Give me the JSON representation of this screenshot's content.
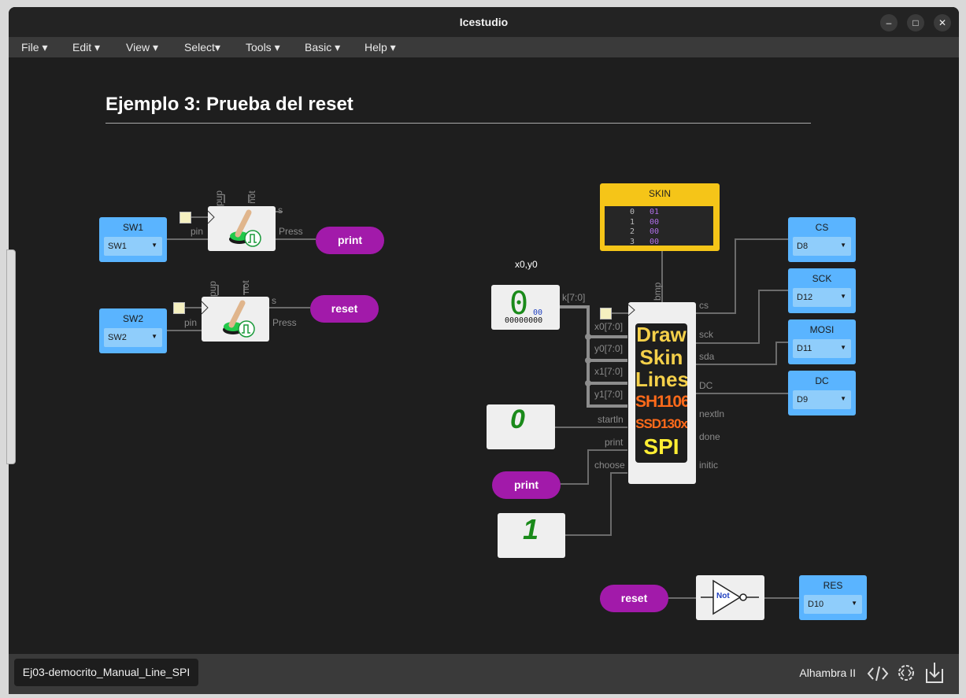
{
  "window": {
    "title": "Icestudio",
    "minimize_glyph": "–",
    "maximize_glyph": "□",
    "close_glyph": "✕"
  },
  "menubar": {
    "items": [
      {
        "label": "File ▾"
      },
      {
        "label": "Edit ▾"
      },
      {
        "label": "View ▾"
      },
      {
        "label": "Select▾"
      },
      {
        "label": "Tools ▾"
      },
      {
        "label": "Basic ▾"
      },
      {
        "label": "Help ▾"
      }
    ]
  },
  "canvas": {
    "heading": "Ejemplo 3: Prueba del reset",
    "sw1": {
      "name": "SW1",
      "value": "SW1"
    },
    "sw2": {
      "name": "SW2",
      "value": "SW2"
    },
    "button_block": {
      "pup": "pup",
      "not": "not",
      "s": "s",
      "pin": "pin",
      "press": "Press"
    },
    "print_label": "print",
    "reset_label": "reset",
    "xy_label": "x0,y0",
    "const_k": {
      "big": "0",
      "small": "00",
      "bits": "00000000"
    },
    "const0_glyph": "0",
    "const1_glyph": "1",
    "skin": {
      "title": "SKIN",
      "rows": [
        {
          "addr": "0",
          "val": "01"
        },
        {
          "addr": "1",
          "val": "00"
        },
        {
          "addr": "2",
          "val": "00"
        },
        {
          "addr": "3",
          "val": "00"
        }
      ]
    },
    "main_block": {
      "lines": [
        "Draw",
        "Skin",
        "Lines",
        "SH1106",
        "SSD130x",
        "SPI"
      ],
      "inputs": [
        "k[7:0]",
        "x0[7:0]",
        "y0[7:0]",
        "x1[7:0]",
        "y1[7:0]",
        "startln",
        "print",
        "choose"
      ],
      "outputs": [
        "cs",
        "sck",
        "sda",
        "DC",
        "nextln",
        "done",
        "initic"
      ],
      "bmp": "bmp"
    },
    "not_gate": "Not",
    "pins": [
      {
        "name": "CS",
        "value": "D8"
      },
      {
        "name": "SCK",
        "value": "D12"
      },
      {
        "name": "MOSI",
        "value": "D11"
      },
      {
        "name": "DC",
        "value": "D9"
      },
      {
        "name": "RES",
        "value": "D10"
      }
    ]
  },
  "statusbar": {
    "file": "Ej03-democrito_Manual_Line_SPI",
    "board": "Alhambra II"
  },
  "colors": {
    "pin": "#5ab4ff",
    "pill": "#a21aaa",
    "skin": "#f5c518",
    "wire": "#6b6b6b"
  }
}
